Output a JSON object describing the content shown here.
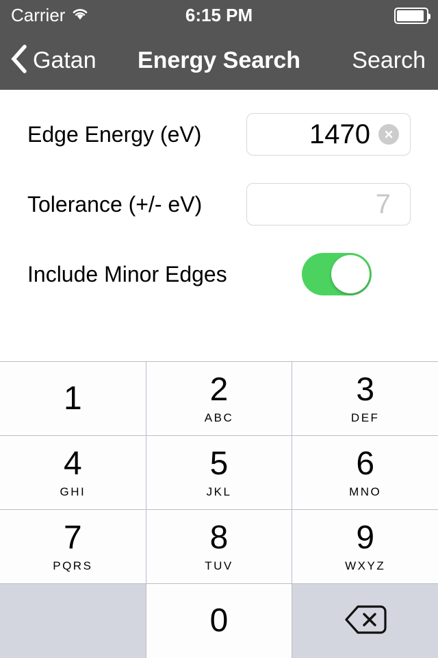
{
  "status_bar": {
    "carrier": "Carrier",
    "wifi_icon": "wifi-icon",
    "time": "6:15 PM",
    "battery_icon": "battery-icon",
    "battery_level_pct": 92
  },
  "nav_bar": {
    "back_icon": "chevron-left-icon",
    "back_label": "Gatan",
    "title": "Energy Search",
    "action_label": "Search",
    "background_color": "#555555",
    "text_color": "#ffffff"
  },
  "form": {
    "edge_energy": {
      "label": "Edge Energy (eV)",
      "value": "1470",
      "placeholder": "",
      "clear_icon": "clear-circle-icon"
    },
    "tolerance": {
      "label": "Tolerance (+/- eV)",
      "value": "",
      "placeholder": "7"
    },
    "include_minor_edges": {
      "label": "Include Minor Edges",
      "state": "on",
      "on_color": "#4cd35f"
    }
  },
  "keypad": {
    "rows": [
      [
        {
          "digit": "1",
          "letters": "",
          "type": "digit"
        },
        {
          "digit": "2",
          "letters": "ABC",
          "type": "digit"
        },
        {
          "digit": "3",
          "letters": "DEF",
          "type": "digit"
        }
      ],
      [
        {
          "digit": "4",
          "letters": "GHI",
          "type": "digit"
        },
        {
          "digit": "5",
          "letters": "JKL",
          "type": "digit"
        },
        {
          "digit": "6",
          "letters": "MNO",
          "type": "digit"
        }
      ],
      [
        {
          "digit": "7",
          "letters": "PQRS",
          "type": "digit"
        },
        {
          "digit": "8",
          "letters": "TUV",
          "type": "digit"
        },
        {
          "digit": "9",
          "letters": "WXYZ",
          "type": "digit"
        }
      ],
      [
        {
          "digit": "",
          "letters": "",
          "type": "blank"
        },
        {
          "digit": "0",
          "letters": "",
          "type": "digit"
        },
        {
          "digit": "",
          "letters": "",
          "type": "delete",
          "icon": "backspace-delete-icon"
        }
      ]
    ],
    "key_background": "#fdfdfd",
    "special_key_background": "#d3d6df",
    "separator_color": "#b9bdc6"
  }
}
